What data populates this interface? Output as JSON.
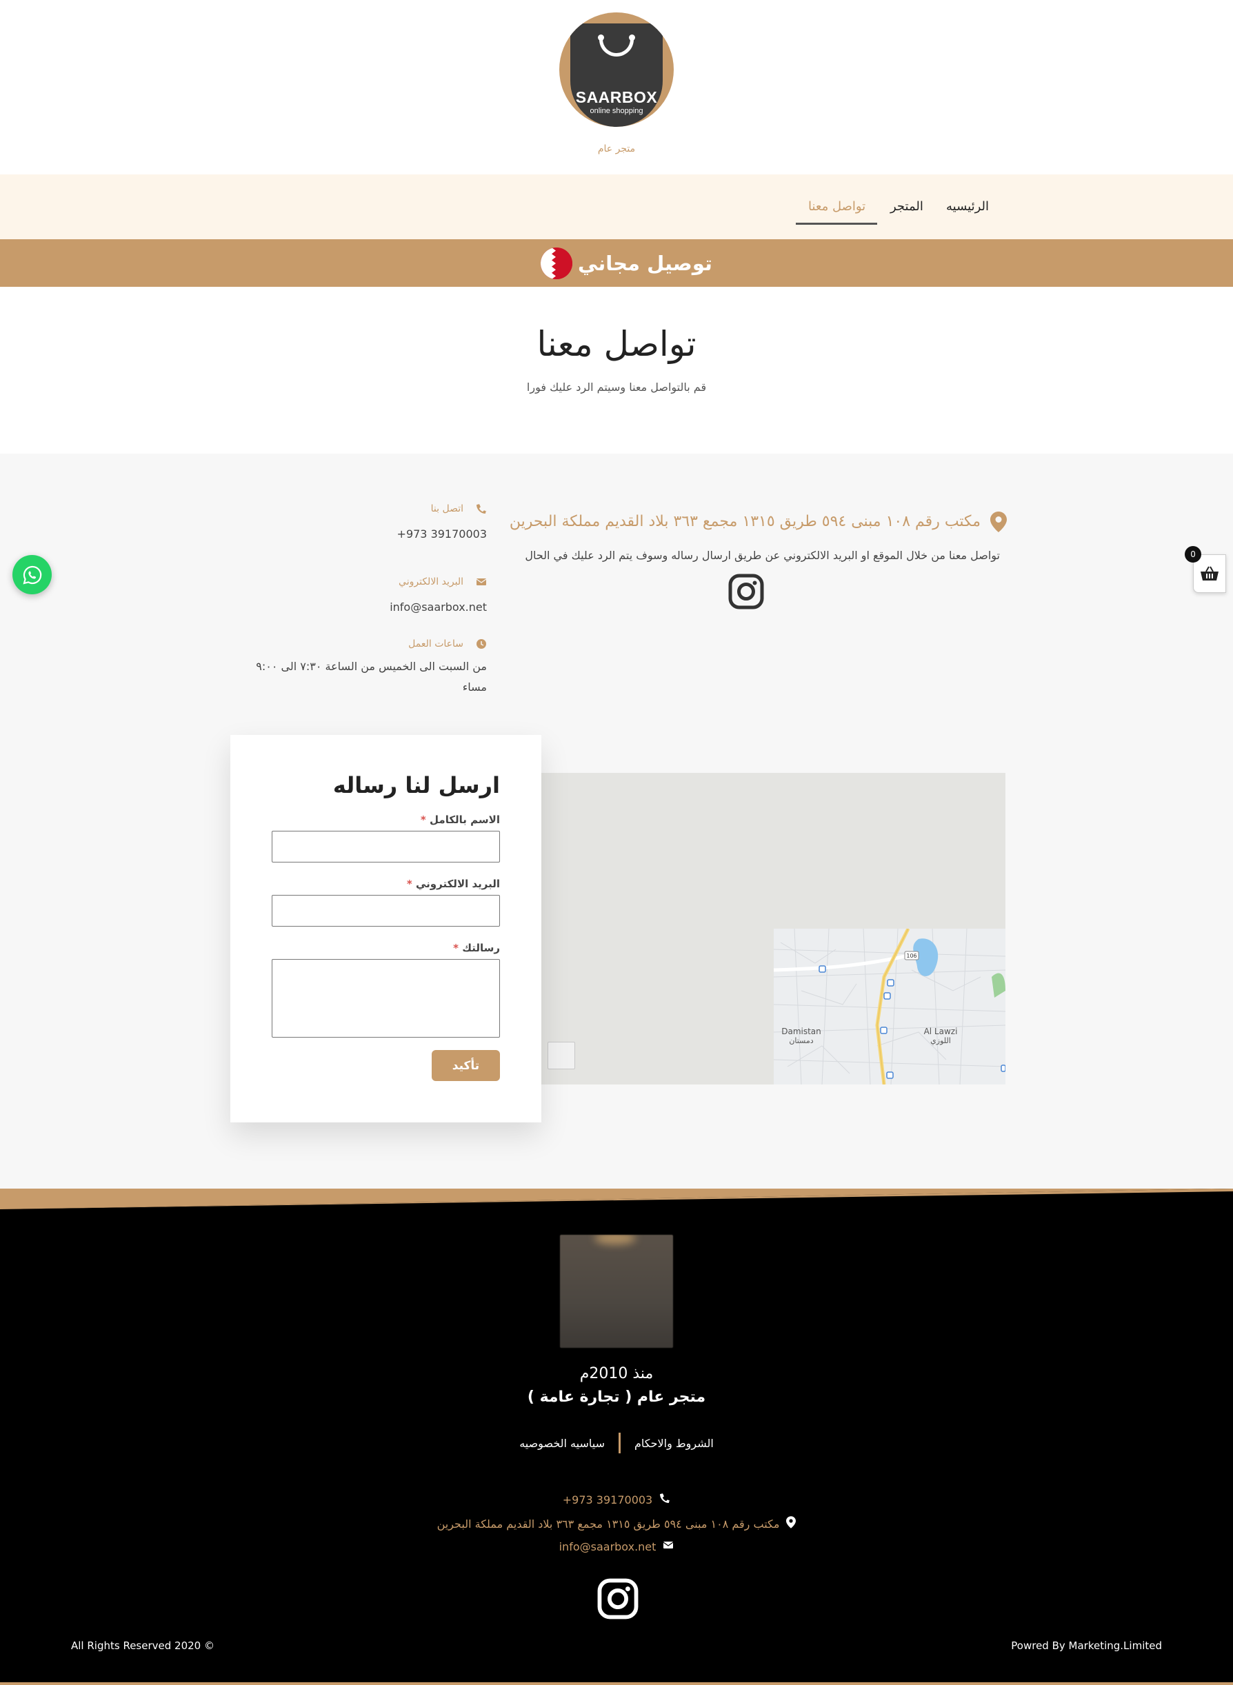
{
  "header": {
    "logo_brand": "SAARBOX",
    "logo_sub": "online shopping",
    "tagline": "متجر عام"
  },
  "nav": {
    "items": [
      {
        "label": "الرئيسيه"
      },
      {
        "label": "المتجر"
      },
      {
        "label": "تواصل معنا"
      }
    ],
    "active_index": 2
  },
  "banner": {
    "text": "توصيل مجاني"
  },
  "page": {
    "title": "تواصل معنا",
    "subtitle": "قم بالتواصل معنا وسيتم الرد عليك فورا"
  },
  "contact": {
    "address": "مكتب رقم ١٠٨ مبنى ٥٩٤ طريق ١٣١٥ مجمع ٣٦٣ بلاد القديم مملكة البحرين",
    "description": "تواصل معنا من خلال الموقع او البريد الالكتروني عن طريق ارسال رساله وسوف يتم الرد عليك في الحال",
    "phone_label": "اتصل بنا",
    "phone": "+973 39170003",
    "email_label": "البريد الالكتروني",
    "email": "info@saarbox.net",
    "hours_label": "ساعات العمل",
    "hours_line1": "من السبت الى الخميس من الساعة ٧:٣٠ الى ٩:٠٠",
    "hours_line2": "مساء"
  },
  "cart": {
    "count": "0"
  },
  "map": {
    "label_damistan": "Damistan",
    "label_damistan_ar": "دمستان",
    "label_lawzi": "Al Lawzi",
    "label_lawzi_ar": "اللوزي",
    "road_number": "106"
  },
  "form": {
    "title": "ارسل لنا رساله",
    "name_label": "الاسم بالكامل",
    "email_label": "البريد الالكتروني",
    "message_label": "رسالتك",
    "required_mark": "*",
    "submit_label": "تأكيد",
    "name_value": "",
    "email_value": "",
    "message_value": ""
  },
  "footer": {
    "since": "منذ 2010م",
    "company": "متجر عام ( تجارة عامة )",
    "terms": "الشروط والاحكام",
    "privacy": "سياسيه الخصوصيه",
    "phone": "+973 39170003",
    "address": "مكتب رقم ١٠٨ مبنى ٥٩٤ طريق ١٣١٥ مجمع ٣٦٣ بلاد القديم مملكة البحرين",
    "email": "info@saarbox.net",
    "copyright": "All Rights Reserved 2020 ©",
    "powered": "Powred By Marketing.Limited"
  },
  "colors": {
    "accent": "#c79b6a",
    "nav_bg": "#fdf5ea",
    "section_bg": "#f7f7f7",
    "footer_bg": "#000000",
    "whatsapp": "#25d366"
  },
  "icons": [
    "shopping-bag-logo",
    "bahrain-flag-icon",
    "location-pin-icon",
    "instagram-icon",
    "phone-icon",
    "envelope-icon",
    "clock-icon",
    "whatsapp-icon",
    "basket-icon"
  ]
}
